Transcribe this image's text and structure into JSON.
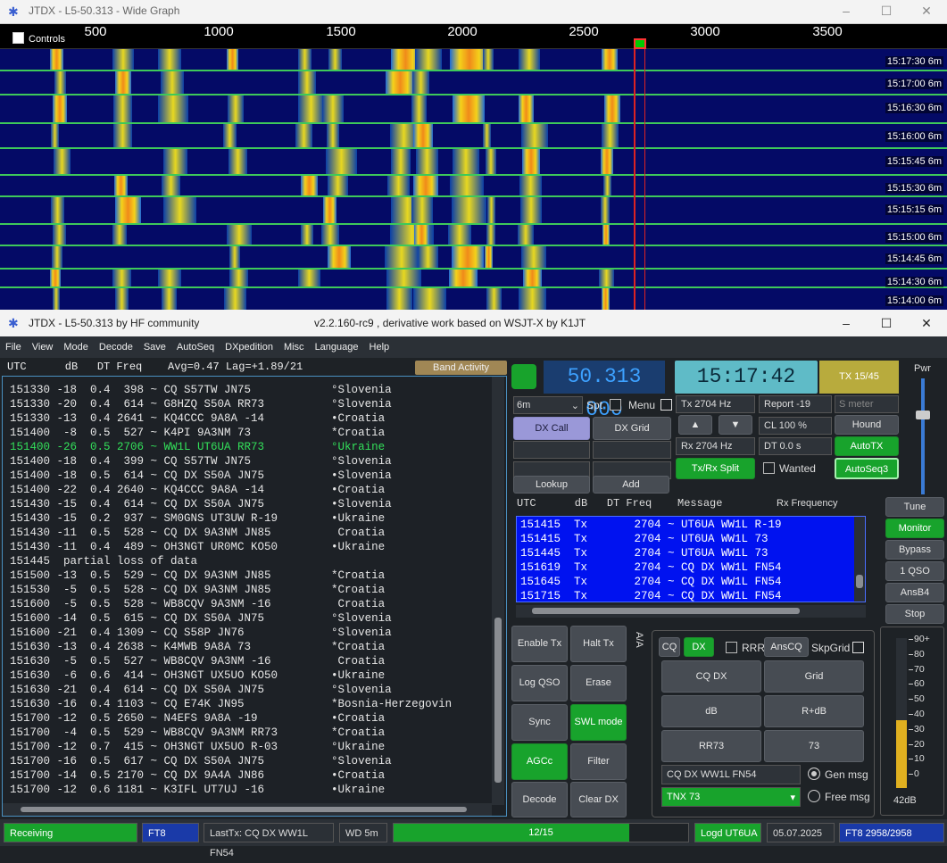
{
  "wide_graph": {
    "title": "JTDX - L5-50.313 - Wide Graph",
    "controls_label": "Controls",
    "scale": [
      "500",
      "1000",
      "1500",
      "2000",
      "2500",
      "3000",
      "3500"
    ],
    "timestamps": [
      {
        "time": "15:17:30",
        "band": "6m"
      },
      {
        "time": "15:17:00",
        "band": "6m"
      },
      {
        "time": "15:16:30",
        "band": "6m"
      },
      {
        "time": "15:16:00",
        "band": "6m"
      },
      {
        "time": "15:15:45",
        "band": "6m"
      },
      {
        "time": "15:15:30",
        "band": "6m"
      },
      {
        "time": "15:15:15",
        "band": "6m"
      },
      {
        "time": "15:15:00",
        "band": "6m"
      },
      {
        "time": "15:14:45",
        "band": "6m"
      },
      {
        "time": "15:14:30",
        "band": "6m"
      },
      {
        "time": "15:14:00",
        "band": "6m"
      }
    ]
  },
  "main": {
    "title": "JTDX - L5-50.313  by HF community",
    "subtitle": "v2.2.160-rc9 , derivative work based on WSJT-X by K1JT",
    "menu": [
      "File",
      "View",
      "Mode",
      "Decode",
      "Save",
      "AutoSeq",
      "DXpedition",
      "Misc",
      "Language",
      "Help"
    ]
  },
  "decode": {
    "header": "UTC      dB   DT Freq    Avg=0.47 Lag=+1.89/21",
    "band_activity": "Band Activity",
    "rows": [
      {
        "t": "151330 -18  0.4  398 ~ CQ S57TW JN75            °Slovenia"
      },
      {
        "t": "151330 -20  0.4  614 ~ G8HZQ S50A RR73          °Slovenia"
      },
      {
        "t": "151330 -13  0.4 2641 ~ KQ4CCC 9A8A -14          •Croatia"
      },
      {
        "t": "151400  -8  0.5  527 ~ K4PI 9A3NM 73            *Croatia"
      },
      {
        "t": "151400 -26  0.5 2706 ~ WW1L UT6UA RR73          °Ukraine",
        "hl": true
      },
      {
        "t": "151400 -18  0.4  399 ~ CQ S57TW JN75            °Slovenia"
      },
      {
        "t": "151400 -18  0.5  614 ~ CQ DX S50A JN75          •Slovenia"
      },
      {
        "t": "151400 -22  0.4 2640 ~ KQ4CCC 9A8A -14          •Croatia"
      },
      {
        "t": "151430 -15  0.4  614 ~ CQ DX S50A JN75          •Slovenia"
      },
      {
        "t": "151430 -15  0.2  937 ~ SM0GNS UT3UW R-19        •Ukraine"
      },
      {
        "t": "151430 -11  0.5  528 ~ CQ DX 9A3NM JN85          Croatia"
      },
      {
        "t": "151430 -11  0.4  489 ~ OH3NGT UR0MC KO50        •Ukraine"
      },
      {
        "t": "151445  partial loss of data"
      },
      {
        "t": "151500 -13  0.5  529 ~ CQ DX 9A3NM JN85         *Croatia"
      },
      {
        "t": "151530  -5  0.5  528 ~ CQ DX 9A3NM JN85         *Croatia"
      },
      {
        "t": "151600  -5  0.5  528 ~ WB8CQV 9A3NM -16          Croatia"
      },
      {
        "t": "151600 -14  0.5  615 ~ CQ DX S50A JN75          °Slovenia"
      },
      {
        "t": "151600 -21  0.4 1309 ~ CQ S58P JN76             °Slovenia"
      },
      {
        "t": "151630 -13  0.4 2638 ~ K4MWB 9A8A 73            *Croatia"
      },
      {
        "t": "151630  -5  0.5  527 ~ WB8CQV 9A3NM -16          Croatia"
      },
      {
        "t": "151630  -6  0.6  414 ~ OH3NGT UX5UO KO50        •Ukraine"
      },
      {
        "t": "151630 -21  0.4  614 ~ CQ DX S50A JN75          °Slovenia"
      },
      {
        "t": "151630 -16  0.4 1103 ~ CQ E74K JN95             *Bosnia-Herzegovin"
      },
      {
        "t": "151700 -12  0.5 2650 ~ N4EFS 9A8A -19           •Croatia"
      },
      {
        "t": "151700  -4  0.5  529 ~ WB8CQV 9A3NM RR73        *Croatia"
      },
      {
        "t": "151700 -12  0.7  415 ~ OH3NGT UX5UO R-03        °Ukraine"
      },
      {
        "t": "151700 -16  0.5  617 ~ CQ DX S50A JN75          °Slovenia"
      },
      {
        "t": "151700 -14  0.5 2170 ~ CQ DX 9A4A JN86          •Croatia"
      },
      {
        "t": "151700 -12  0.6 1181 ~ K3IFL UT7UJ -16          •Ukraine"
      }
    ]
  },
  "right": {
    "freq": "50.313 000",
    "clock": "15:17:42",
    "tx_period": "TX 15/45",
    "pwr_label": "Pwr",
    "band": "6m",
    "spt": "Spt",
    "menu": "Menu",
    "tx_hz": "Tx  2704  Hz",
    "rx_hz": "Rx  2704  Hz",
    "report": "Report -19",
    "smeter": "S meter",
    "cl": "CL  100 %",
    "dt": "DT 0.0 s",
    "dx_call": "DX Call",
    "dx_grid": "DX Grid",
    "hound": "Hound",
    "autotx": "AutoTX",
    "txrx_split": "Tx/Rx Split",
    "wanted": "Wanted",
    "autoseq3": "AutoSeq3",
    "lookup": "Lookup",
    "add": "Add",
    "msg_header": "UTC      dB   DT Freq    Message",
    "rx_freq_label": "Rx Frequency",
    "messages": [
      "151415  Tx       2704 ~ UT6UA WW1L R-19",
      "151415  Tx       2704 ~ UT6UA WW1L 73",
      "151445  Tx       2704 ~ UT6UA WW1L 73",
      "151619  Tx       2704 ~ CQ DX WW1L FN54",
      "151645  Tx       2704 ~ CQ DX WW1L FN54",
      "151715  Tx       2704 ~ CQ DX WW1L FN54"
    ],
    "side_buttons": [
      "Tune",
      "Monitor",
      "Bypass",
      "1 QSO",
      "AnsB4",
      "Stop"
    ],
    "ctrl": {
      "enable_tx": "Enable Tx",
      "halt_tx": "Halt Tx",
      "log_qso": "Log QSO",
      "erase": "Erase",
      "sync": "Sync",
      "swl": "SWL mode",
      "agcc": "AGCc",
      "filter": "Filter",
      "decode": "Decode",
      "clear_dx": "Clear DX"
    },
    "cq": "CQ",
    "dx": "DX",
    "rrr": "RRR",
    "anscq": "AnsCQ",
    "skpgrid": "SkpGrid",
    "msg_buttons": [
      "CQ DX",
      "Grid",
      "dB",
      "R+dB",
      "RR73",
      "73"
    ],
    "gen_msg_value": "CQ DX WW1L FN54",
    "gen_msg": "Gen msg",
    "free_msg_value": "TNX 73",
    "free_msg": "Free msg",
    "az_label": "A/A",
    "meter_ticks": [
      "90+",
      "80",
      "70",
      "60",
      "50",
      "40",
      "30",
      "20",
      "10",
      "0"
    ],
    "meter_value": "42dB",
    "meter_level": 0.45
  },
  "status": {
    "state": "Receiving",
    "mode": "FT8",
    "last_tx": "LastTx: CQ DX WW1L FN54",
    "wd": "WD 5m",
    "progress": "12/15",
    "progress_frac": 0.8,
    "logd": "Logd UT6UA",
    "date": "05.07.2025",
    "ft8_count": "FT8  2958/2958"
  },
  "colors": {
    "green": "#18a32c",
    "accent": "#5fbbc7",
    "freq_bg": "#1a3d6f",
    "msg_bg": "#0012f0"
  }
}
